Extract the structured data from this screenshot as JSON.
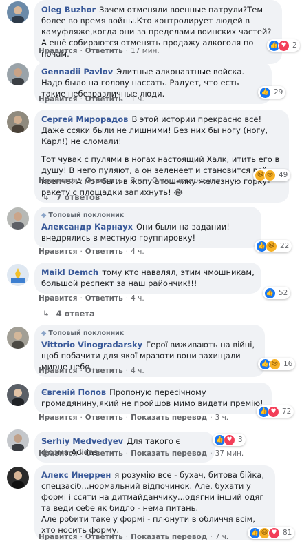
{
  "labels": {
    "like": "Нравится",
    "reply": "Ответить",
    "show_translation": "Показать перевод",
    "edited": "Отредактировано"
  },
  "comments": [
    {
      "name": "Oleg Buzhor",
      "text": "Зачем отменяли военные патрули?Тем более во время войны.Кто контролирует людей в камуфляже,когда они за пределами воинских частей? А ещё собираются отменять продажу алкоголя по ночам.",
      "time": "17 мин.",
      "reactions": [
        "like",
        "love"
      ],
      "count": "2"
    },
    {
      "name": "Gennadii Pavlov",
      "text": "Элитные алконавтные войска. Надо было на голову нассать. Радует, что есть такие небезразличные люди.",
      "time": "1 ч.",
      "reactions": [
        "like"
      ],
      "count": "29"
    },
    {
      "name": "Сергей Мирорадов",
      "text": "В этой истории прекрасно всё! Даже ссяки были не лишними! Без них бы ногу (ногу, Карл!) не сломали!",
      "text2": "Тот чувак с пулями в ногах настоящий Халк, итить его в душу! В него пуляют, а он зеленеет и становится всё крепче! А мог бы и в жопу атошнику железную горку-ракету с площадки запихнуть! 😂",
      "time": "3 ч.",
      "reactions": [
        "haha",
        "sad"
      ],
      "count": "49",
      "replies": "7 ответов"
    },
    {
      "badge": "Топовый поклонник",
      "name": "Александр Карнаух",
      "text": "Они были на задании! внедрялись в местную группировку!",
      "time": "4 ч.",
      "reactions": [
        "like",
        "haha"
      ],
      "count": "22"
    },
    {
      "name": "Maikl Demch",
      "text": "тому кто навалял, этим чмошникам, большой респект за наш райончик!!!",
      "time": "4 ч.",
      "reactions": [
        "like"
      ],
      "count": "52",
      "replies": "4 ответа"
    },
    {
      "badge": "Топовый поклонник",
      "name": "Vittorio Vinogradarsky",
      "text": "Герої виживають на війні, щоб побачити для якої мразоти вони захищали мирне небо...",
      "time": "4 ч.",
      "reactions": [
        "like",
        "sad"
      ],
      "count": "16"
    },
    {
      "name": "Євгеній Попов",
      "text": "Пропоную пересічному громадянину,який не пройшов мимо видати премію!",
      "time": "3 ч.",
      "reactions": [
        "like",
        "love"
      ],
      "count": "72"
    },
    {
      "name": "Serhiy Medvedyev",
      "text": "Для такого є форма Adidas",
      "time": "37 мин.",
      "reactions": [
        "like",
        "love"
      ],
      "count": "3"
    },
    {
      "name": "Алекс Инеррен",
      "text": "я розумію все - бухач, битова бійка, спецзасіб...нормальний відпочинок. Але, бухати у формі і ссяти на дитмайданчику...одягни інший одяг та веди себе як бидло - нема питань.",
      "text2": "Але робити таке у формі - плюнути в обличчя всім, хто носить форму.",
      "time": "7 ч.",
      "reactions": [
        "like",
        "haha",
        "love"
      ],
      "count": "81"
    }
  ],
  "colors": {
    "link": "#385898",
    "bubble": "#f0f2f5",
    "meta": "#65676b",
    "like": "#1877f2",
    "love": "#f33e58",
    "haha": "#f7b125"
  }
}
